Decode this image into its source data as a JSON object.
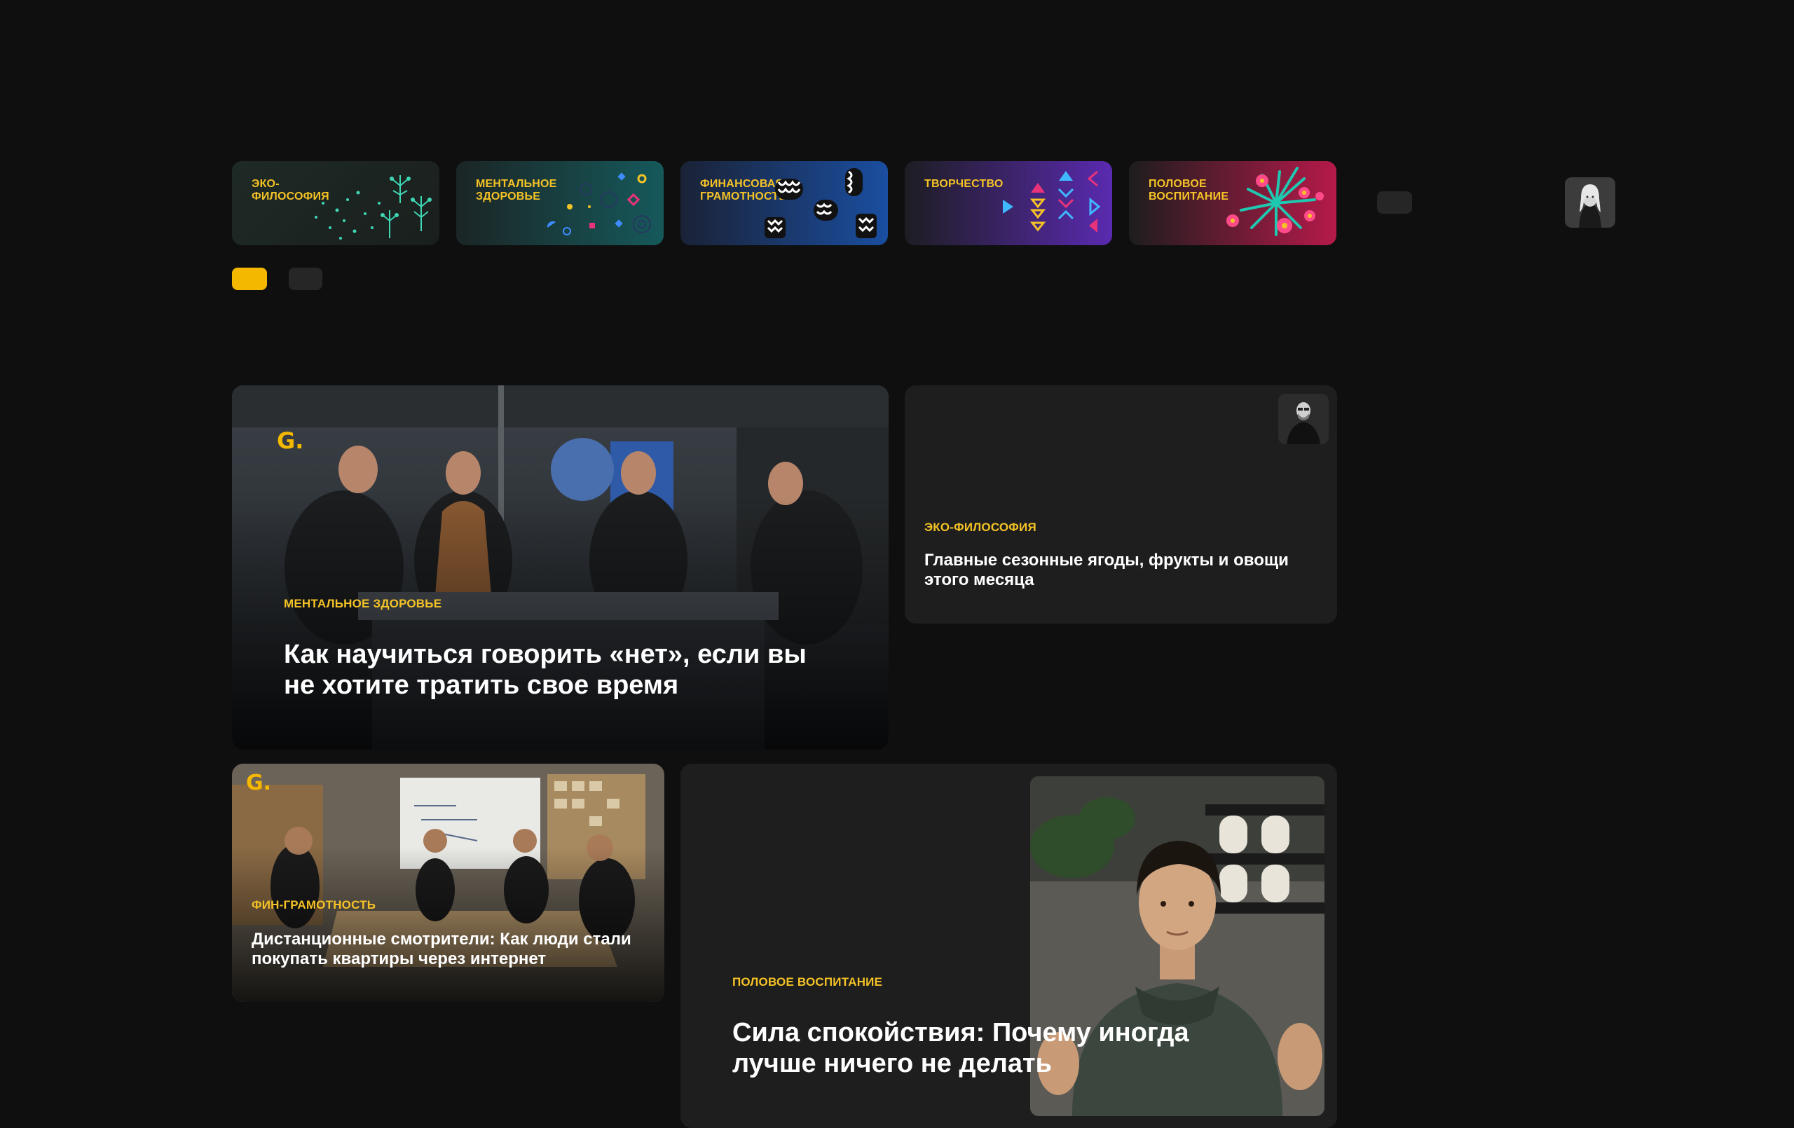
{
  "categories": [
    {
      "label": "ЭКО-ФИЛОСОФИЯ"
    },
    {
      "label": "МЕНТАЛЬНОЕ ЗДОРОВЬЕ"
    },
    {
      "label": "ФИНАНСОВАЯ ГРАМОТНОСТЬ"
    },
    {
      "label": "ТВОРЧЕСТВО"
    },
    {
      "label": "ПОЛОВОЕ ВОСПИТАНИЕ"
    }
  ],
  "brand": {
    "logo_text": "G."
  },
  "colors": {
    "accent": "#f5c326",
    "background": "#0f0f0f",
    "card": "#1e1e1e"
  },
  "articles": {
    "featured": {
      "tag": "МЕНТАЛЬНОЕ ЗДОРОВЬЕ",
      "title": "Как научиться говорить «нет», если вы не хотите тратить свое время"
    },
    "eco": {
      "tag": "ЭКО-ФИЛОСОФИЯ",
      "title": "Главные сезонные ягоды, фрукты и овощи этого месяца"
    },
    "finance": {
      "tag": "ФИН-ГРАМОТНОСТЬ",
      "title": "Дистанционные смотрители: Как люди стали покупать квартиры через интернет"
    },
    "sex_ed": {
      "tag": "ПОЛОВОЕ ВОСПИТАНИЕ",
      "title": "Сила спокойствия: Почему иногда лучше ничего не делать"
    }
  }
}
